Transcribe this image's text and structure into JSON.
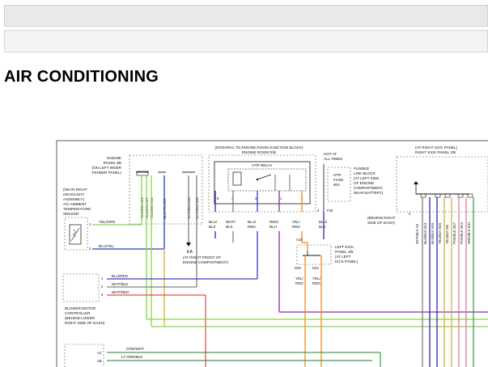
{
  "page": {
    "title": "AIR CONDITIONING"
  },
  "colors": {
    "yel_grn": "#8cd24a",
    "yel_blk": "#d4b43c",
    "blu_yel": "#2a3fb8",
    "wht_blk": "#808080",
    "blu_red": "#3b3bd0",
    "red_blu": "#8a2a9a",
    "yel_red": "#f08a1e",
    "blu_blk": "#2a2ab0",
    "wht_red": "#e05050",
    "lt_grn_blk": "#3aa34a"
  },
  "diagram": {
    "engine_rj": {
      "title": [
        "ENGINE",
        "ROOM J/B",
        "(ON LEFT INNER",
        "FENDER PANEL)"
      ]
    },
    "headlight": {
      "label": [
        "(NEAR RIGHT",
        "HEADLIGHT",
        "ASSEMBLY)",
        "A/C AMBIENT",
        "TEMPERATURE",
        "SENSOR"
      ]
    },
    "sensor_wires": {
      "top": "YEL/GRN",
      "bottom": "BLU/YEL",
      "pin_top": "1",
      "pin_bottom": "2"
    },
    "col_labels": [
      "YEL/GRN A29",
      "YEL/GRN A27",
      "YEL/GRN A10",
      "BLU/YEL B52",
      "WHT/BLK A34",
      "WHT/BLK B50"
    ],
    "junction": {
      "title": [
        "(INTEGRAL TO ENGINE ROOM JUNCTION BLOCK)",
        "ENGINE ROOM R/B"
      ],
      "relay": "HTR RELAY"
    },
    "relay_pins": [
      "5",
      "4",
      "3",
      "1",
      "2"
    ],
    "relay_wires": [
      [
        "BLU/",
        "BLK"
      ],
      [
        "WHT/",
        "BLK"
      ],
      [
        "BLU/",
        "RED"
      ],
      [
        "RED/",
        "BLU"
      ],
      [
        "YEL/",
        "RED"
      ]
    ],
    "hot": {
      "label": [
        "HOT AT",
        "ALL TIMES"
      ],
      "fuse": [
        "HTR",
        "FUSE",
        "50A"
      ],
      "fuse_pin": "4",
      "fuse_pin2": "F4b"
    },
    "fusible": {
      "label": [
        "FUSIBLE",
        "LINK BLOCK",
        "(AT LEFT SIDE",
        "OF ENGINE",
        "COMPARTMENT,",
        "NEAR BATTERY)"
      ]
    },
    "fuse_wire": [
      "BLU/",
      "BLK"
    ],
    "ground": {
      "name": "EA",
      "label": [
        "(AT RIGHT FRONT OF",
        "ENGINE COMPARTMENT)"
      ]
    },
    "left_kick": {
      "pin_top": "A19",
      "pin_left": "D29",
      "pin_right": "D33",
      "label": [
        "LEFT KICK",
        "PANEL J/B",
        "(AT LEFT",
        "KICK PANEL)"
      ]
    },
    "kick_wires": [
      [
        "YEL/",
        "RED"
      ],
      [
        "YEL/",
        "RED"
      ]
    ],
    "blower": {
      "pins": [
        "1",
        "2",
        "3"
      ],
      "wires": [
        "BLU/RED",
        "WHT/BLK",
        "WHT/RED"
      ],
      "label": [
        "BLOWER MOTOR",
        "CONTROLLER",
        "(BEHIND LOWER",
        "RIGHT SIDE OF DASH)"
      ]
    },
    "right_kick": {
      "title": [
        "(AT RIGHT KICK PANEL)",
        "RIGHT KICK PANEL J/B"
      ],
      "ground": "II",
      "ground_label": [
        "(BEHIND RIGHT",
        "SIDE OF DASH)"
      ]
    },
    "right_cols": [
      "WHT/BLK H2",
      "BLU/BLK M14",
      "BLU/BLK M15",
      "YEL/BLK M16",
      "YEL/BLK M6",
      "PNK/BLK M17",
      "PNK/BLK M13",
      "GRN/BLK M11"
    ],
    "bottom": {
      "pins": [
        "AC",
        "AB"
      ],
      "wires": [
        "GRN/WHT",
        "LT GRN/BLK"
      ]
    }
  }
}
